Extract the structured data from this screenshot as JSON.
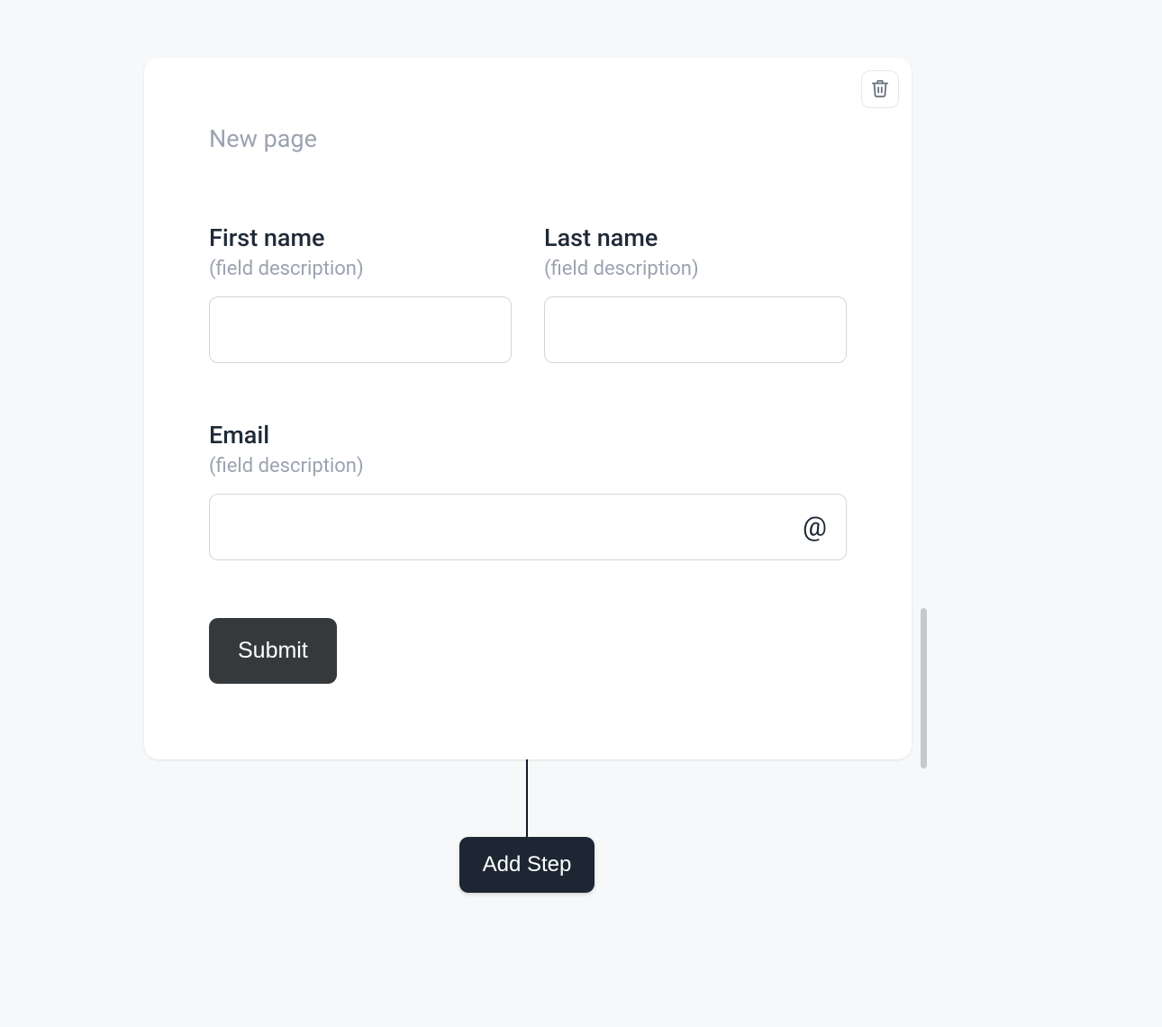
{
  "page": {
    "title": "New page"
  },
  "fields": {
    "first_name": {
      "label": "First name",
      "description": "(field description)",
      "value": ""
    },
    "last_name": {
      "label": "Last name",
      "description": "(field description)",
      "value": ""
    },
    "email": {
      "label": "Email",
      "description": "(field description)",
      "value": "",
      "icon": "at-icon"
    }
  },
  "buttons": {
    "submit": "Submit",
    "add_step": "Add Step"
  },
  "icons": {
    "trash": "trash-icon",
    "at": "@"
  }
}
